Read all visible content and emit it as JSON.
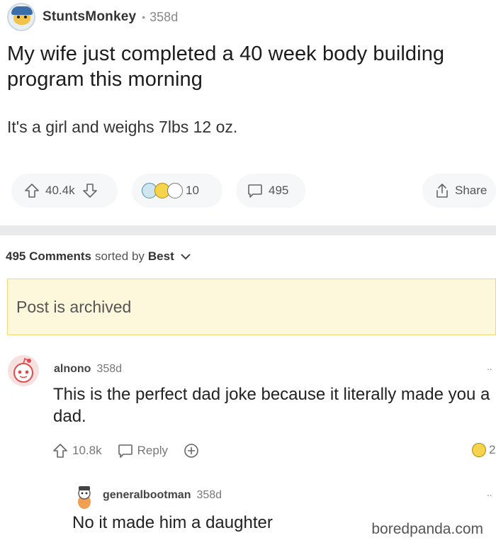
{
  "post": {
    "username": "StuntsMonkey",
    "separator": "•",
    "age": "358d",
    "title": "My wife just completed a 40 week body building program this morning",
    "body": "It's a girl and weighs 7lbs 12 oz.",
    "votes": "40.4k",
    "awards_count": "10",
    "comments_count": "495",
    "share_label": "Share"
  },
  "sort": {
    "count": "495",
    "comments_word": "Comments",
    "sorted_by": "sorted by",
    "order": "Best"
  },
  "archived_notice": "Post is archived",
  "comments": [
    {
      "username": "alnono",
      "age": "358d",
      "text": "This is the perfect dad joke because it literally made you a dad.",
      "votes": "10.8k",
      "reply_label": "Reply",
      "award_count": "2"
    },
    {
      "username": "generalbootman",
      "age": "358d",
      "text": "No it made him a daughter"
    }
  ],
  "watermark": "boredpanda.com",
  "icons": {
    "upvote": "arrow-up-icon",
    "downvote": "arrow-down-icon",
    "comment": "speech-bubble-icon",
    "share": "share-icon",
    "add_award": "plus-circle-icon",
    "sort_chevron": "chevron-down-icon",
    "more": "more-dots-icon"
  },
  "colors": {
    "archived_bg": "#fdf7dc",
    "archived_border": "#f0d87a",
    "divider": "#e9eaeb"
  }
}
